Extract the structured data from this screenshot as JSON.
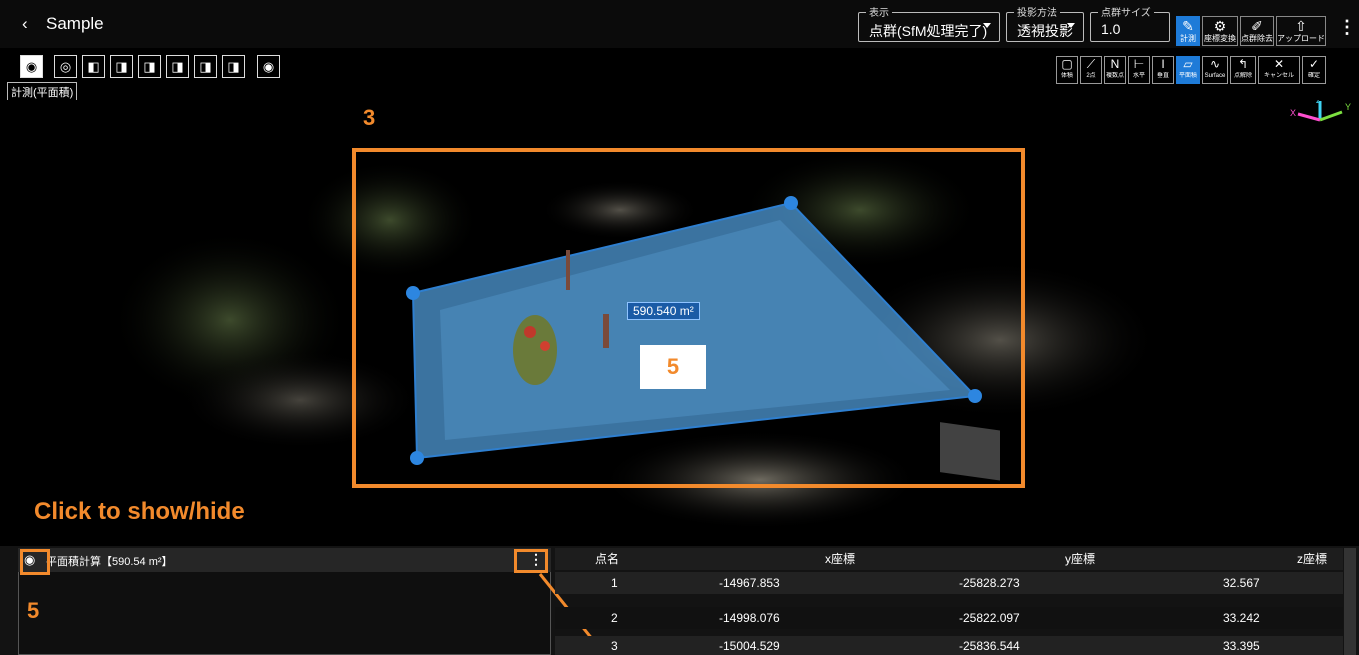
{
  "header": {
    "back_icon": "chevron-left-icon",
    "title": "Sample",
    "display": {
      "label": "表示",
      "value": "点群(SfM処理完了)"
    },
    "projection": {
      "label": "投影方法",
      "value": "透視投影"
    },
    "point_size": {
      "label": "点群サイズ",
      "value": "1.0"
    },
    "tools": [
      {
        "icon": "ruler-icon",
        "label": "計測",
        "active": true
      },
      {
        "icon": "coordinate-icon",
        "label": "座標変換",
        "active": false
      },
      {
        "icon": "eraser-icon",
        "label": "点群除去",
        "active": false
      },
      {
        "icon": "upload-icon",
        "label": "アップロード",
        "active": false
      }
    ]
  },
  "toolbar": {
    "view_buttons": [
      "camera-icon",
      "target-icon",
      "cube-view-icon",
      "cube-front-icon",
      "cube-back-icon",
      "cube-left-icon",
      "cube-right-icon",
      "cube-top-icon",
      "eye-icon"
    ],
    "tooltip": "計測(平面積)",
    "measure_buttons": [
      {
        "icon": "volume-icon",
        "label": "体積",
        "active": false
      },
      {
        "icon": "two-point-icon",
        "label": "2点",
        "active": false
      },
      {
        "icon": "multi-point-icon",
        "label": "複数点",
        "active": false
      },
      {
        "icon": "horizontal-icon",
        "label": "水平",
        "active": false
      },
      {
        "icon": "vertical-icon",
        "label": "垂直",
        "active": false
      },
      {
        "icon": "plane-area-icon",
        "label": "平面積",
        "active": true
      },
      {
        "icon": "surface-icon",
        "label": "Surface",
        "active": false
      },
      {
        "icon": "undo-icon",
        "label": "点解除",
        "active": false
      },
      {
        "icon": "close-icon",
        "label": "キャンセル",
        "active": false
      },
      {
        "icon": "check-icon",
        "label": "確定",
        "active": false
      }
    ]
  },
  "viewport": {
    "area_label": "590.540 m²",
    "axis": {
      "x": "X",
      "y": "Y",
      "z": "Z"
    }
  },
  "annotations": {
    "label_3": "3",
    "label_5_box": "5",
    "show_hide": "Click to show/hide",
    "label_5_bottom": "5"
  },
  "panel": {
    "title": "平面積計算【590.54 m²】"
  },
  "table": {
    "headers": [
      "点名",
      "x座標",
      "y座標",
      "z座標"
    ],
    "rows": [
      [
        "1",
        "-14967.853",
        "-25828.273",
        "32.567"
      ],
      [
        "2",
        "-14998.076",
        "-25822.097",
        "33.242"
      ],
      [
        "3",
        "-15004.529",
        "-25836.544",
        "33.395"
      ]
    ]
  },
  "colors": {
    "accent": "#1e7bd8",
    "annotation": "#f28a2c",
    "area_fill": "#4a90c8"
  }
}
